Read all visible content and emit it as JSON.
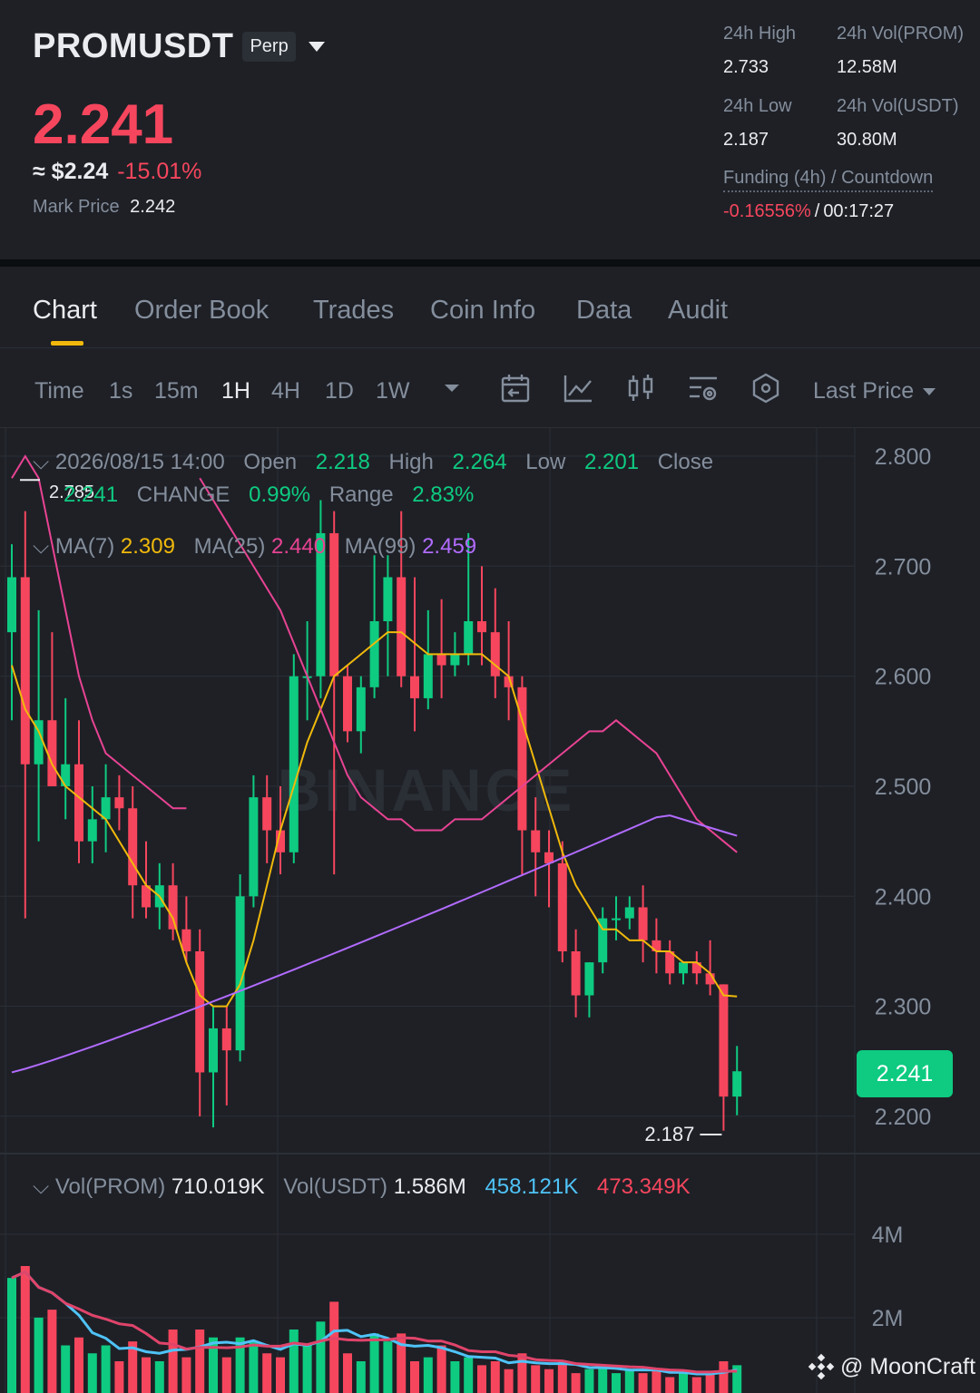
{
  "header": {
    "symbol": "PROMUSDT",
    "badge": "Perp",
    "last_price": "2.241",
    "usd_approx": "≈ $2.24",
    "change_pct": "-15.01%",
    "mark_price_label": "Mark Price",
    "mark_price": "2.242",
    "stats": {
      "high_label": "24h High",
      "high": "2.733",
      "vol_prom_label": "24h Vol(PROM)",
      "vol_prom": "12.58M",
      "low_label": "24h Low",
      "low": "2.187",
      "vol_usdt_label": "24h Vol(USDT)",
      "vol_usdt": "30.80M"
    },
    "funding_label": "Funding (4h) / Countdown",
    "funding_rate": "-0.16556%",
    "funding_sep": "/",
    "countdown": "00:17:27"
  },
  "tabs": [
    "Chart",
    "Order Book",
    "Trades",
    "Coin Info",
    "Data",
    "Audit"
  ],
  "toolbar": {
    "time_label": "Time",
    "intervals": [
      "1s",
      "15m",
      "1H",
      "4H",
      "1D",
      "1W"
    ],
    "active_interval": "1H",
    "price_type": "Last Price"
  },
  "ohlc": {
    "datetime": "2026/08/15 14:00",
    "open_label": "Open",
    "open": "2.218",
    "high_label": "High",
    "high": "2.264",
    "low_label": "Low",
    "low": "2.201",
    "close_label": "Close",
    "close": "2.241",
    "change_label": "CHANGE",
    "change": "0.99%",
    "range_label": "Range",
    "range": "2.83%"
  },
  "ma": {
    "ma7_label": "MA(7)",
    "ma7": "2.309",
    "ma25_label": "MA(25)",
    "ma25": "2.440",
    "ma99_label": "MA(99)",
    "ma99": "2.459"
  },
  "volume_legend": {
    "label": "Vol(PROM)",
    "value": "710.019K",
    "usdt_label": "Vol(USDT)",
    "usdt_value": "1.586M",
    "ma_a": "458.121K",
    "ma_b": "473.349K"
  },
  "markers": {
    "high": "2.785",
    "low": "2.187"
  },
  "current_price_tag": "2.241",
  "watermark": "BINANCE",
  "credit": "@ MoonCraft",
  "colors": {
    "up": "#0ecb81",
    "down": "#f6465d",
    "ma7": "#f0b90b",
    "ma25": "#e84393",
    "ma99": "#b26bff",
    "accent": "#f0b90b"
  },
  "chart_data": {
    "type": "candlestick",
    "interval": "1H",
    "y_axis": {
      "ticks": [
        2.8,
        2.7,
        2.6,
        2.5,
        2.4,
        2.3,
        2.2
      ],
      "tick_labels": [
        "2.800",
        "2.700",
        "2.600",
        "2.500",
        "2.400",
        "2.300",
        "2.200"
      ]
    },
    "volume_axis": {
      "ticks": [
        "4M",
        "2M"
      ]
    },
    "candles": [
      {
        "o": 2.64,
        "h": 2.72,
        "l": 2.56,
        "c": 2.69
      },
      {
        "o": 2.69,
        "h": 2.75,
        "l": 2.38,
        "c": 2.52
      },
      {
        "o": 2.52,
        "h": 2.66,
        "l": 2.45,
        "c": 2.56
      },
      {
        "o": 2.56,
        "h": 2.64,
        "l": 2.51,
        "c": 2.5
      },
      {
        "o": 2.5,
        "h": 2.58,
        "l": 2.47,
        "c": 2.52
      },
      {
        "o": 2.52,
        "h": 2.56,
        "l": 2.43,
        "c": 2.45
      },
      {
        "o": 2.45,
        "h": 2.5,
        "l": 2.43,
        "c": 2.47
      },
      {
        "o": 2.47,
        "h": 2.52,
        "l": 2.44,
        "c": 2.49
      },
      {
        "o": 2.49,
        "h": 2.51,
        "l": 2.46,
        "c": 2.48
      },
      {
        "o": 2.48,
        "h": 2.5,
        "l": 2.38,
        "c": 2.41
      },
      {
        "o": 2.41,
        "h": 2.45,
        "l": 2.38,
        "c": 2.39
      },
      {
        "o": 2.39,
        "h": 2.43,
        "l": 2.37,
        "c": 2.41
      },
      {
        "o": 2.41,
        "h": 2.43,
        "l": 2.36,
        "c": 2.37
      },
      {
        "o": 2.37,
        "h": 2.4,
        "l": 2.34,
        "c": 2.35
      },
      {
        "o": 2.35,
        "h": 2.37,
        "l": 2.2,
        "c": 2.24
      },
      {
        "o": 2.24,
        "h": 2.3,
        "l": 2.19,
        "c": 2.28
      },
      {
        "o": 2.28,
        "h": 2.3,
        "l": 2.21,
        "c": 2.26
      },
      {
        "o": 2.26,
        "h": 2.42,
        "l": 2.25,
        "c": 2.4
      },
      {
        "o": 2.4,
        "h": 2.51,
        "l": 2.39,
        "c": 2.49
      },
      {
        "o": 2.49,
        "h": 2.51,
        "l": 2.43,
        "c": 2.46
      },
      {
        "o": 2.46,
        "h": 2.5,
        "l": 2.42,
        "c": 2.44
      },
      {
        "o": 2.44,
        "h": 2.62,
        "l": 2.43,
        "c": 2.6
      },
      {
        "o": 2.6,
        "h": 2.65,
        "l": 2.56,
        "c": 2.6
      },
      {
        "o": 2.6,
        "h": 2.76,
        "l": 2.58,
        "c": 2.73
      },
      {
        "o": 2.73,
        "h": 2.75,
        "l": 2.42,
        "c": 2.6
      },
      {
        "o": 2.6,
        "h": 2.61,
        "l": 2.54,
        "c": 2.55
      },
      {
        "o": 2.55,
        "h": 2.6,
        "l": 2.53,
        "c": 2.59
      },
      {
        "o": 2.59,
        "h": 2.71,
        "l": 2.58,
        "c": 2.65
      },
      {
        "o": 2.65,
        "h": 2.71,
        "l": 2.6,
        "c": 2.69
      },
      {
        "o": 2.69,
        "h": 2.75,
        "l": 2.59,
        "c": 2.6
      },
      {
        "o": 2.6,
        "h": 2.69,
        "l": 2.55,
        "c": 2.58
      },
      {
        "o": 2.58,
        "h": 2.66,
        "l": 2.57,
        "c": 2.62
      },
      {
        "o": 2.62,
        "h": 2.67,
        "l": 2.58,
        "c": 2.61
      },
      {
        "o": 2.61,
        "h": 2.64,
        "l": 2.6,
        "c": 2.62
      },
      {
        "o": 2.62,
        "h": 2.73,
        "l": 2.61,
        "c": 2.65
      },
      {
        "o": 2.65,
        "h": 2.7,
        "l": 2.61,
        "c": 2.64
      },
      {
        "o": 2.64,
        "h": 2.68,
        "l": 2.58,
        "c": 2.6
      },
      {
        "o": 2.6,
        "h": 2.65,
        "l": 2.56,
        "c": 2.59
      },
      {
        "o": 2.59,
        "h": 2.6,
        "l": 2.42,
        "c": 2.46
      },
      {
        "o": 2.46,
        "h": 2.49,
        "l": 2.4,
        "c": 2.44
      },
      {
        "o": 2.44,
        "h": 2.46,
        "l": 2.39,
        "c": 2.43
      },
      {
        "o": 2.43,
        "h": 2.45,
        "l": 2.34,
        "c": 2.35
      },
      {
        "o": 2.35,
        "h": 2.37,
        "l": 2.29,
        "c": 2.31
      },
      {
        "o": 2.31,
        "h": 2.34,
        "l": 2.29,
        "c": 2.34
      },
      {
        "o": 2.34,
        "h": 2.39,
        "l": 2.33,
        "c": 2.38
      },
      {
        "o": 2.38,
        "h": 2.4,
        "l": 2.36,
        "c": 2.38
      },
      {
        "o": 2.38,
        "h": 2.4,
        "l": 2.37,
        "c": 2.39
      },
      {
        "o": 2.39,
        "h": 2.41,
        "l": 2.34,
        "c": 2.36
      },
      {
        "o": 2.36,
        "h": 2.38,
        "l": 2.33,
        "c": 2.35
      },
      {
        "o": 2.35,
        "h": 2.36,
        "l": 2.32,
        "c": 2.33
      },
      {
        "o": 2.33,
        "h": 2.34,
        "l": 2.32,
        "c": 2.34
      },
      {
        "o": 2.34,
        "h": 2.35,
        "l": 2.32,
        "c": 2.33
      },
      {
        "o": 2.33,
        "h": 2.36,
        "l": 2.31,
        "c": 2.32
      },
      {
        "o": 2.32,
        "h": 2.32,
        "l": 2.187,
        "c": 2.218
      },
      {
        "o": 2.218,
        "h": 2.264,
        "l": 2.201,
        "c": 2.241
      }
    ],
    "volumes_m": [
      2.9,
      3.2,
      1.9,
      2.1,
      1.2,
      1.4,
      1.0,
      1.2,
      0.8,
      1.3,
      0.9,
      0.8,
      1.6,
      0.9,
      1.6,
      1.4,
      0.9,
      1.4,
      1.3,
      1.0,
      0.9,
      1.6,
      1.2,
      1.8,
      2.3,
      1.0,
      0.8,
      1.5,
      1.3,
      1.5,
      0.8,
      0.9,
      1.2,
      0.8,
      0.9,
      0.7,
      0.8,
      0.6,
      1.0,
      0.7,
      0.6,
      0.8,
      0.5,
      0.6,
      0.7,
      0.5,
      0.6,
      0.5,
      0.6,
      0.4,
      0.5,
      0.4,
      0.5,
      0.8,
      0.7
    ],
    "ma7": [
      2.61,
      2.57,
      2.55,
      2.52,
      2.5,
      2.49,
      2.48,
      2.47,
      2.45,
      2.43,
      2.41,
      2.4,
      2.38,
      2.34,
      2.31,
      2.3,
      2.3,
      2.32,
      2.36,
      2.41,
      2.46,
      2.5,
      2.54,
      2.57,
      2.6,
      2.61,
      2.62,
      2.63,
      2.64,
      2.64,
      2.63,
      2.62,
      2.62,
      2.62,
      2.62,
      2.62,
      2.61,
      2.6,
      2.56,
      2.52,
      2.48,
      2.44,
      2.41,
      2.39,
      2.37,
      2.37,
      2.36,
      2.36,
      2.35,
      2.35,
      2.34,
      2.34,
      2.33,
      2.31,
      2.309
    ],
    "ma25": [
      2.78,
      2.76,
      2.74,
      2.72,
      2.7,
      2.68,
      2.66,
      2.63,
      2.6,
      2.57,
      2.54,
      2.51,
      2.49,
      2.48,
      2.47,
      2.47,
      2.46,
      2.46,
      2.46,
      2.47,
      2.47,
      2.47,
      2.48,
      2.49,
      2.5,
      2.51,
      2.52,
      2.53,
      2.54,
      2.55,
      2.55,
      2.56,
      2.55,
      2.54,
      2.53,
      2.51,
      2.49,
      2.47,
      2.46,
      2.45,
      2.44
    ]
  }
}
